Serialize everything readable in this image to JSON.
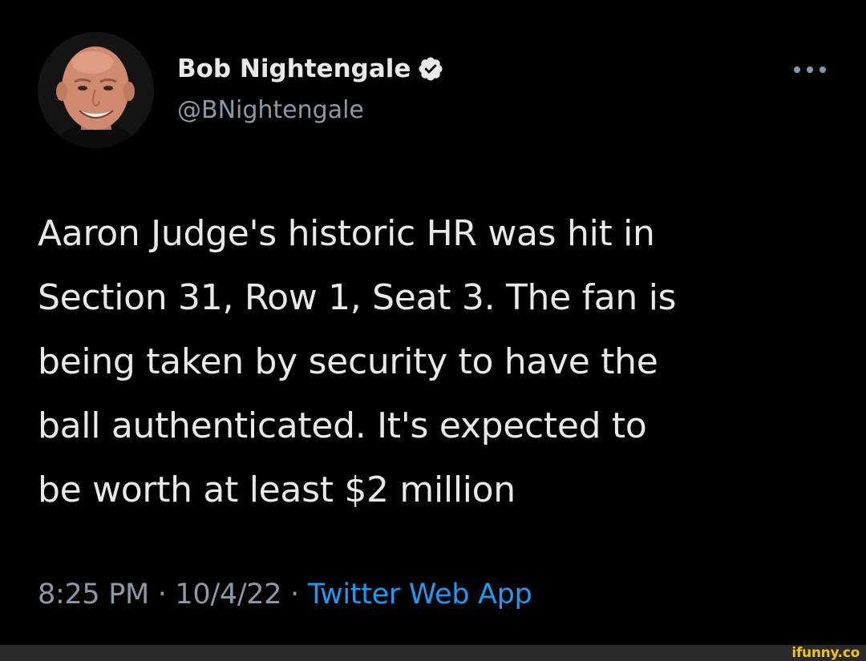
{
  "tweet": {
    "author": {
      "display_name": "Bob Nightengale",
      "handle": "@BNightengale",
      "verified": true,
      "avatar_icon": "profile-photo"
    },
    "more_icon": "more-dots-icon",
    "text_lines": [
      "Aaron Judge's historic HR was hit in",
      "Section 31, Row 1, Seat 3. The fan is",
      "being taken by security to have the",
      "ball authenticated. It's expected to",
      "be worth at least $2 million"
    ],
    "time": "8:25 PM",
    "date": "10/4/22",
    "separator": "·",
    "source": "Twitter Web App"
  },
  "watermark": {
    "text": "ifunny.co"
  },
  "colors": {
    "background": "#000000",
    "primary_text": "#e7e9ea",
    "secondary_text": "#8b98a5",
    "link": "#1d9bf0",
    "watermark": "#f5c400",
    "footer_bar": "#2a2a2a"
  }
}
